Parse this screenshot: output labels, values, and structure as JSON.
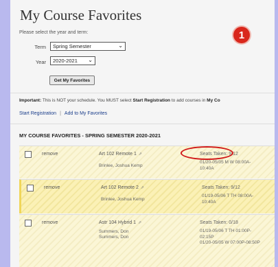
{
  "page": {
    "title": "My Course Favorites",
    "badge_number": "1",
    "hint": "Please select the year and term:"
  },
  "form": {
    "term_label": "Term",
    "term_value": "Spring Semester",
    "year_label": "Year",
    "year_value": "2020-2021",
    "get_button": "Get My Favorites"
  },
  "notice": {
    "important_label": "Important:",
    "text": "This is NOT your schedule. You MUST select",
    "bold_link": "Start Registration",
    "text2": "to add courses in",
    "tail": "My Co"
  },
  "links": {
    "start_registration": "Start Registration",
    "separator": "|",
    "add_favorites": "Add to My Favorites"
  },
  "section_title": "MY COURSE FAVORITES - SPRING SEMESTER 2020-2021",
  "rows": [
    {
      "remove": "remove",
      "course": "Art 102 Remote 1",
      "instructor": "Brinlee, Joshua Kemp",
      "seats": "Seats Taken: 9/12",
      "times": [
        "01/20-05/05 M W 08:00A-",
        "10:40A"
      ]
    },
    {
      "remove": "remove",
      "course": "Art 102 Remote 2",
      "instructor": "Brinlee, Joshua Kemp",
      "seats": "Seats Taken: 9/12",
      "times": [
        "01/19-05/06 T TH 08:00A-",
        "10:40A"
      ]
    },
    {
      "remove": "remove",
      "course": "Astr 104 Hybrid 1",
      "instructor": [
        "Summers, Don",
        "Summers, Don"
      ],
      "seats": "Seats Taken: 0/18",
      "times": [
        "01/19-05/06 T TH 01:00P-",
        "02:15P",
        "01/20-05/05 W 07:00P-08:50P"
      ]
    }
  ],
  "colors": {
    "annotation_red": "#d11a1a",
    "highlight_row": "#fbf1b6",
    "page_background": "#b9b9ee"
  }
}
